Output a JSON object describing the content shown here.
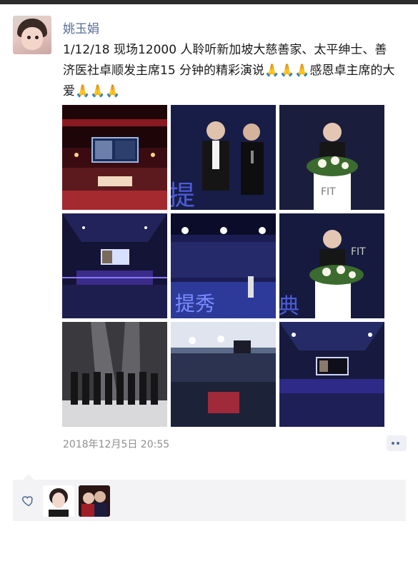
{
  "post": {
    "author": "姚玉娟",
    "text": "1/12/18 现场12000 人聆听新加坡大慈善家、太平绅士、善济医社卓顺发主席15 分钟的精彩演说🙏🙏🙏感恩卓主席的大爱🙏🙏🙏",
    "timestamp": "2018年12月5日 20:55",
    "photo_count": 9
  },
  "icons": {
    "comment": "comment-dots-icon",
    "like": "heart-outline-icon"
  },
  "likes": {
    "avatars": [
      "liker-avatar-1",
      "liker-avatar-2"
    ]
  },
  "colors": {
    "link": "#576b95",
    "text": "#1a1a1a",
    "meta": "#8f8f8f",
    "likes_bg": "#f3f3f5"
  }
}
